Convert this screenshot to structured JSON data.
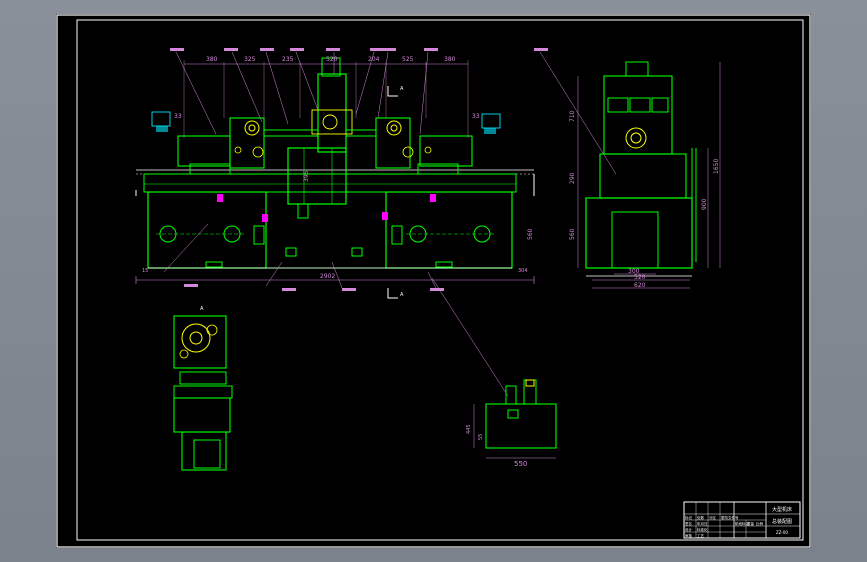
{
  "drawing": {
    "dimensions": {
      "d1": "380",
      "d2": "325",
      "d3": "235",
      "d4": "520",
      "d5": "204",
      "d6": "525",
      "d7": "380",
      "d8": "33",
      "d9": "33",
      "total_length": "2902",
      "side_width_a": "300",
      "side_width_b": "520",
      "side_width_c": "620",
      "side_h1": "710",
      "side_h2": "290",
      "side_h3": "560",
      "side_total_height": "1650",
      "side_h4": "900",
      "front_h": "560",
      "front_h2": "395",
      "left_bottom": "15",
      "right_bottom": "304",
      "tank_width": "550",
      "tank_h1": "445",
      "tank_h2": "55"
    },
    "section_mark": "A"
  },
  "title_block": {
    "title_top": "大型机床",
    "title_main": "总装配图",
    "code": "ZZ-00",
    "row_labels": [
      "标记",
      "处数",
      "分区",
      "更改文件号",
      "签名",
      "年月日"
    ],
    "role_design": "设计",
    "role_check": "审核",
    "role_std": "标准化",
    "role_process": "工艺",
    "stage": "阶段标记",
    "weight": "重量",
    "scale": "比例"
  },
  "colors": {
    "sheet": "#000000",
    "frame": "#ffffff",
    "body": "#00ff00",
    "dimension": "#d28ad8",
    "highlight": "#ffff00",
    "cyan": "#00e5ff",
    "magenta": "#ff00ff",
    "red": "#ff3030"
  }
}
